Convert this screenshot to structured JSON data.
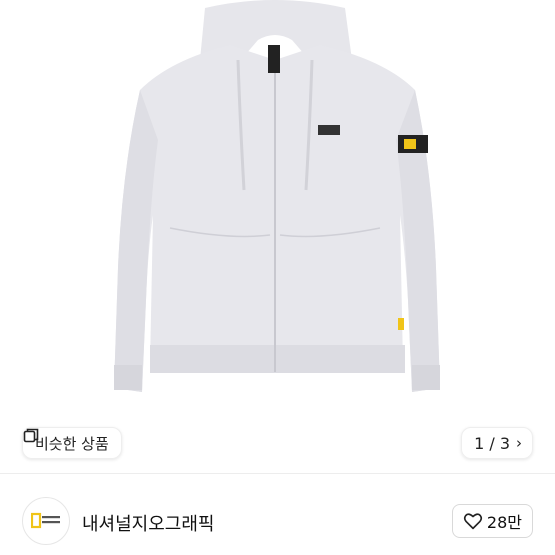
{
  "similar": {
    "label": "비슷한 상품"
  },
  "gallery": {
    "counter": "1 / 3"
  },
  "shop": {
    "name": "내셔널지오그래픽",
    "likes": "28만"
  },
  "colors": {
    "hoodie": "#e7e7ec",
    "hoodie_shadow": "#d6d6dc",
    "patch_yellow": "#f0c419"
  },
  "icons": {
    "similar": "stacked-squares-icon",
    "next": "chevron-right-icon",
    "like": "heart-outline-icon"
  }
}
